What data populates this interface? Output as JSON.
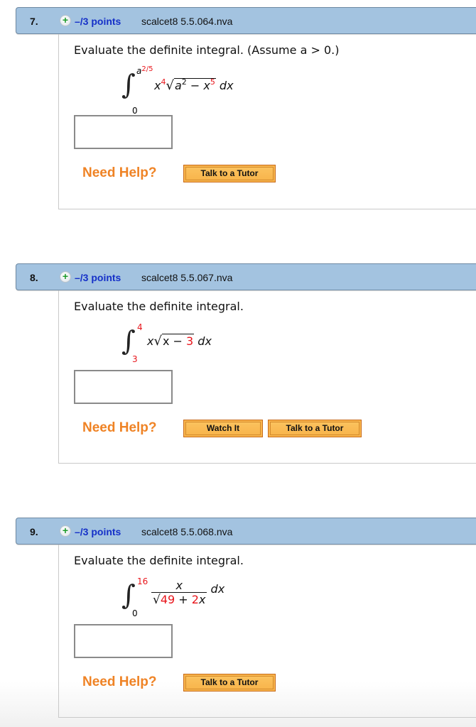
{
  "questions": [
    {
      "number": "7.",
      "points": "–/3 points",
      "code": "scalcet8 5.5.064.nva",
      "prompt": "Evaluate the definite integral. (Assume a > 0.)",
      "integral": {
        "upper_base": "a",
        "upper_exp": "2/5",
        "lower": "0",
        "integrand_parts": {
          "x": "x",
          "x_exp": "4",
          "a": "a",
          "a_exp": "2",
          "minus": "−",
          "x2": "x",
          "x2_exp": "5"
        },
        "dx": "dx"
      },
      "answer_value": "",
      "need_help": "Need Help?",
      "buttons": [
        "Talk to a Tutor"
      ]
    },
    {
      "number": "8.",
      "points": "–/3 points",
      "code": "scalcet8 5.5.067.nva",
      "prompt": "Evaluate the definite integral.",
      "integral": {
        "upper": "4",
        "lower": "3",
        "integrand_parts": {
          "x": "x",
          "inner": "x − ",
          "const": "3"
        },
        "dx": "dx"
      },
      "answer_value": "",
      "need_help": "Need Help?",
      "buttons": [
        "Watch It",
        "Talk to a Tutor"
      ]
    },
    {
      "number": "9.",
      "points": "–/3 points",
      "code": "scalcet8 5.5.068.nva",
      "prompt": "Evaluate the definite integral.",
      "integral": {
        "upper": "16",
        "lower": "0",
        "numerator": "x",
        "denominator_parts": {
          "a": "49",
          "plus": " + ",
          "coef": "2",
          "var": "x"
        },
        "dx": "dx"
      },
      "answer_value": "",
      "need_help": "Need Help?",
      "buttons": [
        "Talk to a Tutor"
      ]
    }
  ],
  "icons": {
    "expand": "plus-circle-icon"
  },
  "colors": {
    "header_bg": "#a3c3e0",
    "points": "#1530c8",
    "need_help": "#ef8325",
    "button": "#f8b54c",
    "highlight": "#e8151b"
  }
}
